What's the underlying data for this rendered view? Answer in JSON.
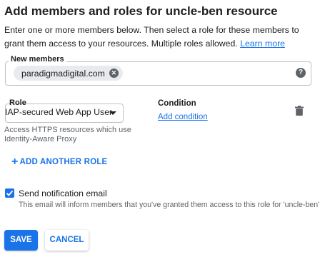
{
  "title": "Add members and roles for uncle-ben resource",
  "description": {
    "text": "Enter one or more members below. Then select a role for these members to grant them access to your resources. Multiple roles allowed.",
    "learn_more": "Learn more"
  },
  "members": {
    "label": "New members",
    "chips": [
      "paradigmadigital.com"
    ],
    "icons": {
      "chip_remove": "cancel-circle-icon",
      "help": "help-icon"
    }
  },
  "role": {
    "label": "Role",
    "selected": "IAP-secured Web App User",
    "hint": "Access HTTPS resources which use Identity-Aware Proxy"
  },
  "condition": {
    "label": "Condition",
    "link": "Add condition"
  },
  "add_role_label": "ADD ANOTHER ROLE",
  "notification": {
    "label": "Send notification email",
    "checked": true,
    "subtext": "This email will inform members that you've granted them access to this role for 'uncle-ben'"
  },
  "buttons": {
    "save": "SAVE",
    "cancel": "CANCEL"
  },
  "colors": {
    "accent": "#1a73e8",
    "text": "#202124",
    "secondary_text": "#5f6368"
  }
}
